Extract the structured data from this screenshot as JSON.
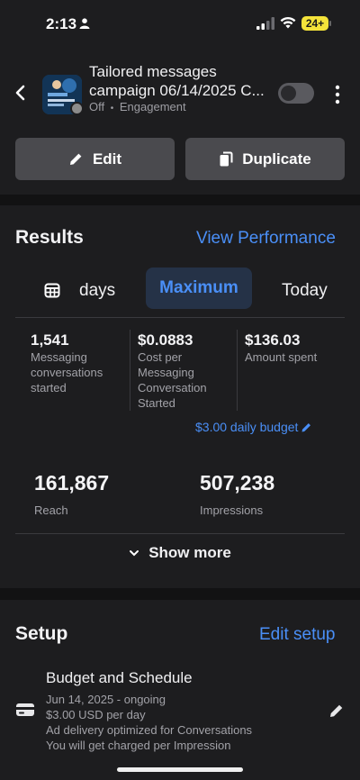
{
  "status_bar": {
    "time": "2:13",
    "battery": "24+"
  },
  "header": {
    "title_line1": "Tailored messages",
    "title_line2": "campaign 06/14/2025 C...",
    "status": "Off",
    "separator": "•",
    "objective": "Engagement"
  },
  "actions": {
    "edit_label": "Edit",
    "duplicate_label": "Duplicate"
  },
  "results": {
    "title": "Results",
    "view_performance_label": "View Performance",
    "tabs": [
      {
        "label": "days"
      },
      {
        "label": "Maximum"
      },
      {
        "label": "Today"
      }
    ],
    "metrics": [
      {
        "value": "1,541",
        "label_lines": [
          "Messaging",
          "conversations",
          "started"
        ]
      },
      {
        "value": "$0.0883",
        "label_lines": [
          "Cost per",
          "Messaging",
          "Conversation",
          "Started"
        ]
      },
      {
        "value": "$136.03",
        "label_lines": [
          "Amount spent"
        ]
      }
    ],
    "daily_budget": "$3.00 daily budget",
    "reach": {
      "value": "161,867",
      "label": "Reach"
    },
    "impressions": {
      "value": "507,238",
      "label": "Impressions"
    },
    "show_more_label": "Show more"
  },
  "setup": {
    "title": "Setup",
    "edit_setup_label": "Edit setup",
    "budget_schedule": {
      "title": "Budget and Schedule",
      "lines": [
        "Jun 14, 2025 - ongoing",
        "$3.00 USD per day",
        "Ad delivery optimized for Conversations",
        "You will get charged per Impression"
      ]
    }
  },
  "colors": {
    "background": "#1d1d1f",
    "accent_blue": "#4a8ff7",
    "selected_tab_bg": "#253247",
    "button_bg": "#4a4a4e",
    "battery_yellow": "#f4e33a"
  }
}
